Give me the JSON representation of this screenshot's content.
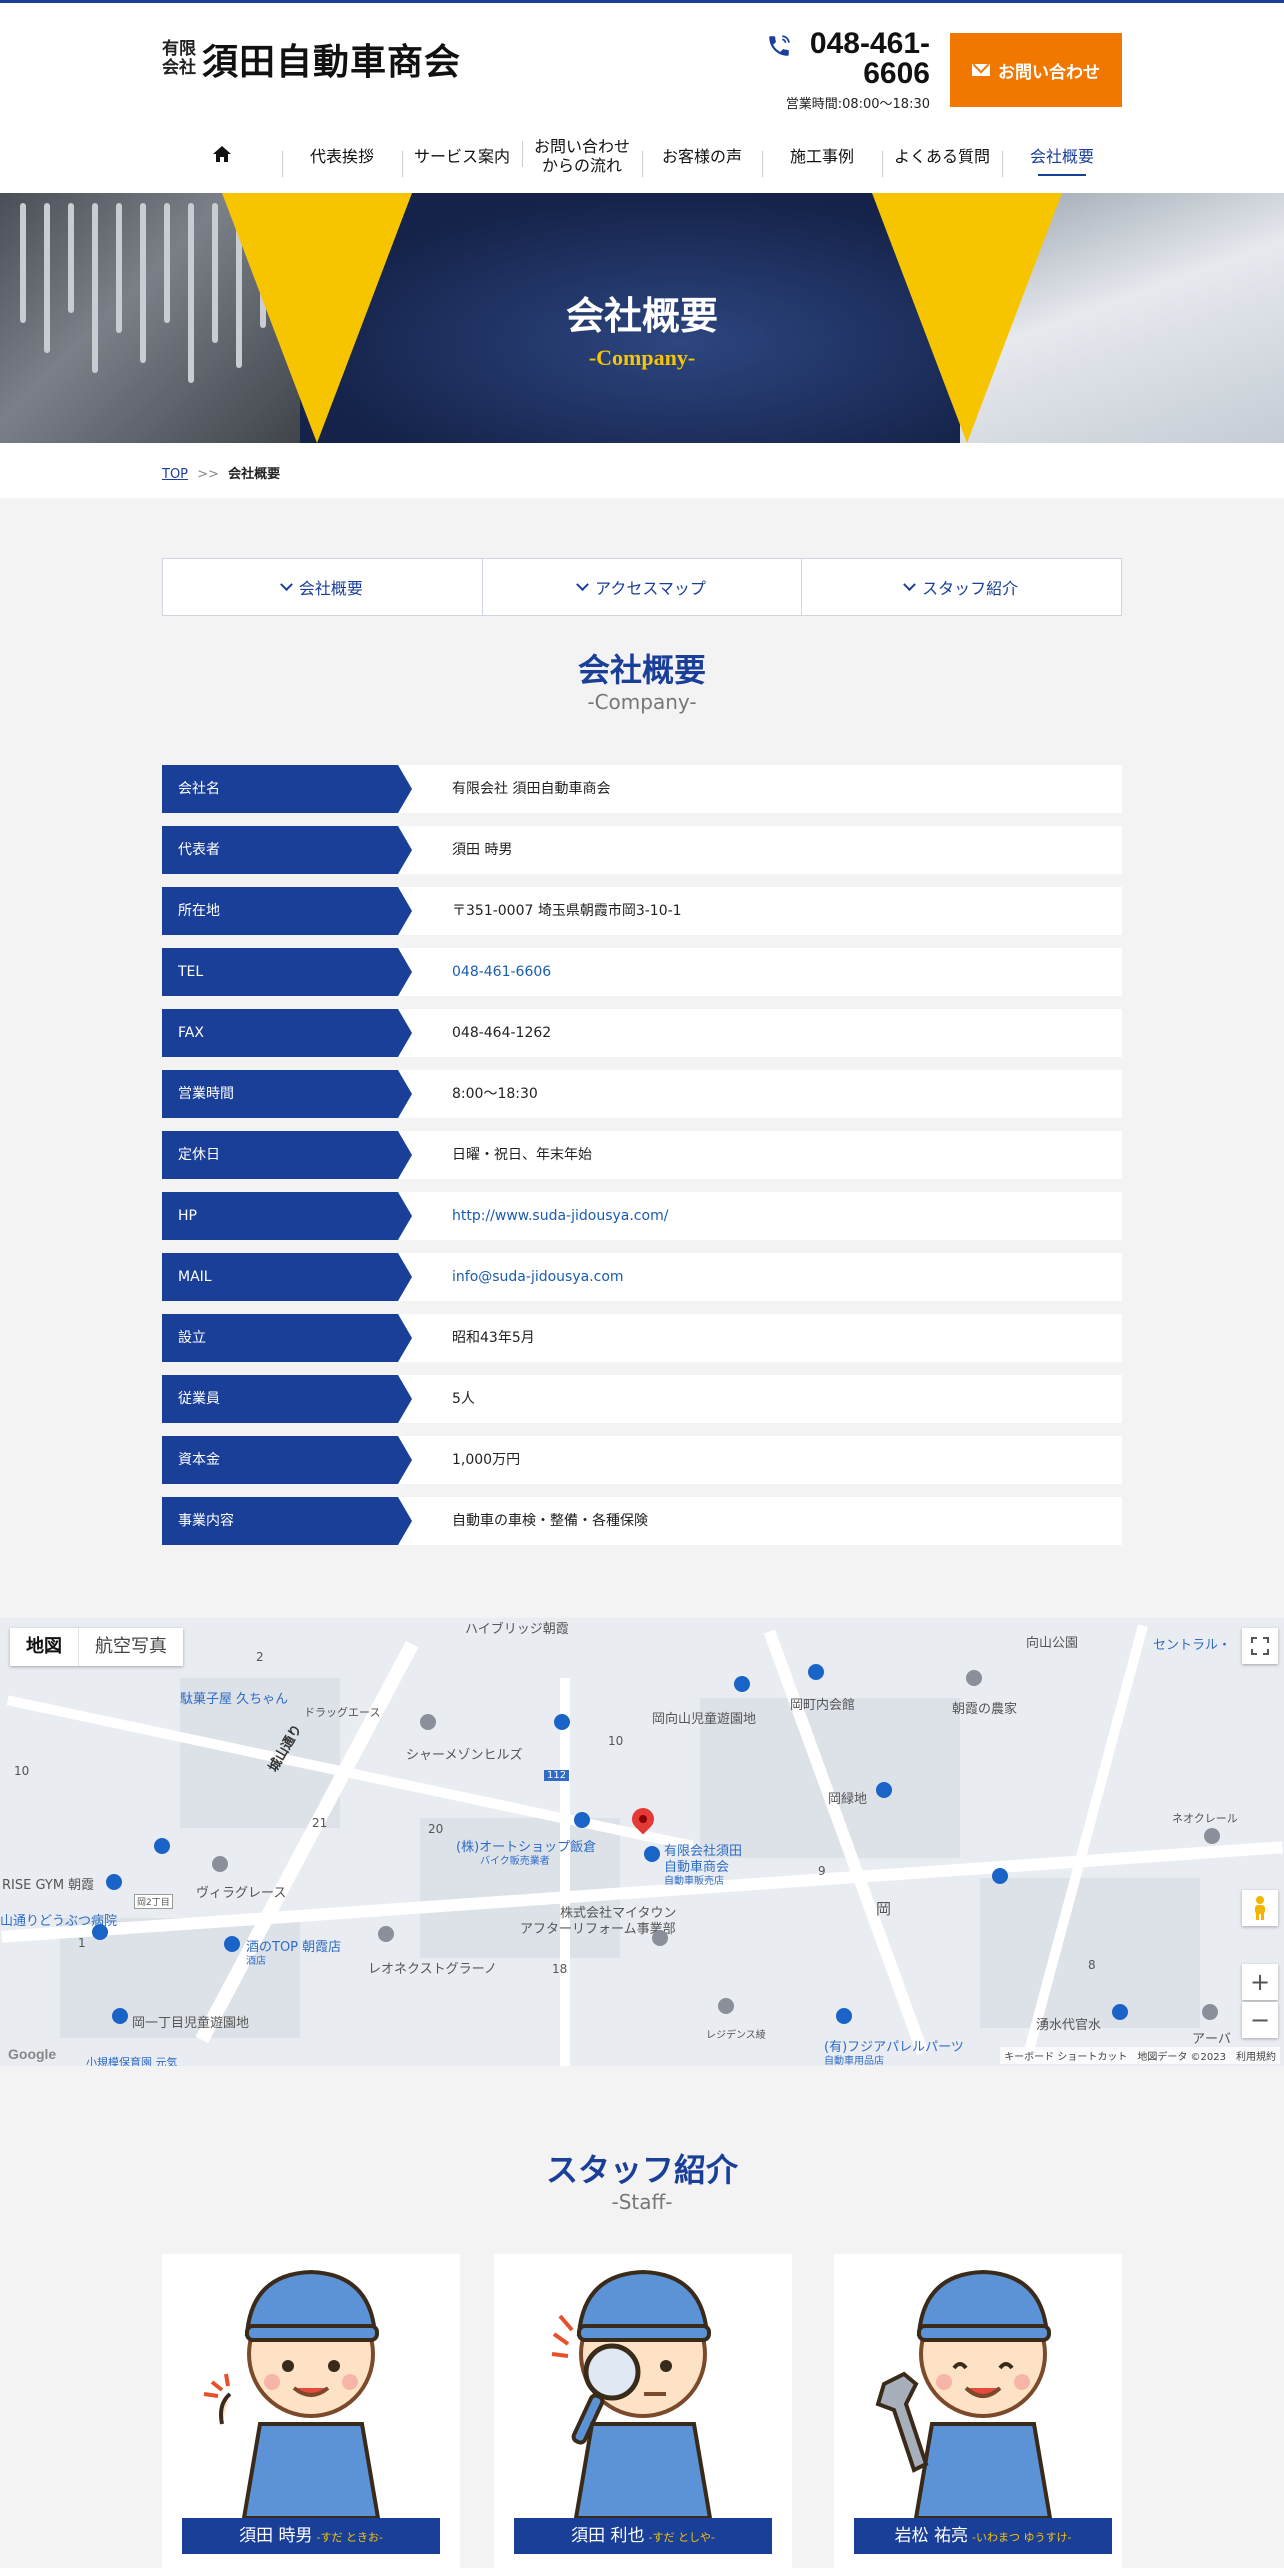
{
  "header": {
    "logo_small_1": "有限",
    "logo_small_2": "会社",
    "logo_main": "須田自動車商会",
    "phone_line1": "048-461-",
    "phone_line2": "6606",
    "hours": "営業時間:08:00～18:30",
    "contact_label": "お問い合わせ"
  },
  "nav": {
    "items": [
      {
        "label": ""
      },
      {
        "label": "代表挨拶"
      },
      {
        "label": "サービス案内"
      },
      {
        "label": "お問い合わせ\nからの流れ"
      },
      {
        "label": "お客様の声"
      },
      {
        "label": "施工事例"
      },
      {
        "label": "よくある質問"
      },
      {
        "label": "会社概要"
      }
    ]
  },
  "hero": {
    "title": "会社概要",
    "subtitle": "-Company-"
  },
  "breadcrumb": {
    "home": "TOP",
    "sep": ">>",
    "current": "会社概要"
  },
  "tabs": [
    {
      "label": "会社概要"
    },
    {
      "label": "アクセスマップ"
    },
    {
      "label": "スタッフ紹介"
    }
  ],
  "company": {
    "title": "会社概要",
    "subtitle": "-Company-",
    "rows": [
      {
        "label": "会社名",
        "value": "有限会社 須田自動車商会"
      },
      {
        "label": "代表者",
        "value": "須田 時男"
      },
      {
        "label": "所在地",
        "value": "〒351-0007 埼玉県朝霞市岡3-10-1"
      },
      {
        "label": "TEL",
        "value": "048-461-6606"
      },
      {
        "label": "FAX",
        "value": "048-464-1262"
      },
      {
        "label": "営業時間",
        "value": "8:00〜18:30"
      },
      {
        "label": "定休日",
        "value": "日曜・祝日、年末年始"
      },
      {
        "label": "HP",
        "value": "http://www.suda-jidousya.com/"
      },
      {
        "label": "MAIL",
        "value": "info@suda-jidousya.com"
      },
      {
        "label": "設立",
        "value": "昭和43年5月"
      },
      {
        "label": "従業員",
        "value": "5人"
      },
      {
        "label": "資本金",
        "value": "1,000万円"
      },
      {
        "label": "事業内容",
        "value": "自動車の車検・整備・各種保険"
      }
    ]
  },
  "map": {
    "btn_map": "地図",
    "btn_satellite": "航空写真",
    "labels": {
      "hybridge": "ハイブリッジ朝霞",
      "kouen": "向山公園",
      "central": "セントラル・",
      "dagashi": "駄菓子屋 久ちゃん",
      "drug": "ドラッグエース",
      "jouyama": "城山通り",
      "shamaison": "シャーメゾンヒルズ",
      "mukaiyama_park": "岡向山児童遊園地",
      "choukai": "岡町内会館",
      "farm": "朝霞の農家",
      "okaato": "岡緑地",
      "autoshop1": "(株)オートショップ飯倉",
      "autoshop2": "バイク販売業者",
      "suda1": "有限会社須田",
      "suda2": "自動車商会",
      "suda3": "自動車販売店",
      "neo": "ネオクレール",
      "risegym": "RISE GYM 朝霞",
      "villa": "ヴィラグレース",
      "animal": "山通りどうぶつ病院",
      "sake": "酒のTOP 朝霞店",
      "sake2": "酒店",
      "myhome1": "株式会社マイタウン",
      "myhome2": "アフターリフォーム事業部",
      "leonet": "レオネクストグラーノ",
      "oka": "岡",
      "park2": "岡一丁目児童遊園地",
      "residence": "レジデンス綾",
      "apparel": "(有)フジアパレルパーツ",
      "apparel2": "自動車用品店",
      "yusui": "湧水代官水",
      "apa": "アーバ",
      "n2": "2",
      "n10a": "10",
      "n10b": "10",
      "n112": "112",
      "n21": "21",
      "n20": "20",
      "n9": "9",
      "n18": "18",
      "n8": "8",
      "n1": "1",
      "oka2": "岡2丁目",
      "footer": "キーボード ショートカット　地図データ ©2023　利用規約",
      "google": "Google",
      "bottom_cut": "小規模保育園 元気"
    }
  },
  "staff": {
    "title": "スタッフ紹介",
    "subtitle": "-Staff-",
    "members": [
      {
        "name": "須田 時男",
        "kana": "-すだ ときお-"
      },
      {
        "name": "須田 利也",
        "kana": "-すだ としや-"
      },
      {
        "name": "岩松 祐亮",
        "kana": "-いわまつ ゆうすけ-"
      }
    ]
  },
  "colors": {
    "brand": "#1a3f99",
    "accent": "#f07800",
    "yellow": "#f7c500"
  }
}
